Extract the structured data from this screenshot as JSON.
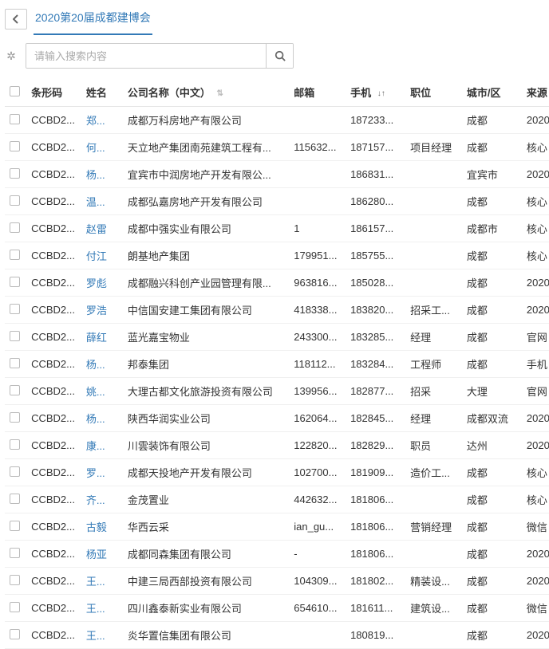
{
  "header": {
    "tab_label": "2020第20届成都建博会"
  },
  "search": {
    "placeholder": "请输入搜索内容"
  },
  "columns": {
    "barcode": "条形码",
    "name": "姓名",
    "company": "公司名称（中文）",
    "email": "邮箱",
    "phone": "手机",
    "position": "职位",
    "city": "城市/区",
    "source": "来源"
  },
  "rows": [
    {
      "barcode": "CCBD2...",
      "name": "郑...",
      "company": "成都万科房地产有限公司",
      "email": "",
      "phone": "187233...",
      "position": "",
      "city": "成都",
      "source": "2020"
    },
    {
      "barcode": "CCBD2...",
      "name": "何...",
      "company": "天立地产集团南苑建筑工程有...",
      "email": "115632...",
      "phone": "187157...",
      "position": "项目经理",
      "city": "成都",
      "source": "核心"
    },
    {
      "barcode": "CCBD2...",
      "name": "杨...",
      "company": "宜宾市中润房地产开发有限公...",
      "email": "",
      "phone": "186831...",
      "position": "",
      "city": "宜宾市",
      "source": "2020"
    },
    {
      "barcode": "CCBD2...",
      "name": "温...",
      "company": "成都弘嘉房地产开发有限公司",
      "email": "",
      "phone": "186280...",
      "position": "",
      "city": "成都",
      "source": "核心"
    },
    {
      "barcode": "CCBD2...",
      "name": "赵雷",
      "company": "成都中强实业有限公司",
      "email": "1",
      "phone": "186157...",
      "position": "",
      "city": "成都市",
      "source": "核心"
    },
    {
      "barcode": "CCBD2...",
      "name": "付江",
      "company": "朗基地产集团",
      "email": "179951...",
      "phone": "185755...",
      "position": "",
      "city": "成都",
      "source": "核心"
    },
    {
      "barcode": "CCBD2...",
      "name": "罗彪",
      "company": "成都融兴科创产业园管理有限...",
      "email": "963816...",
      "phone": "185028...",
      "position": "",
      "city": "成都",
      "source": "2020"
    },
    {
      "barcode": "CCBD2...",
      "name": "罗浩",
      "company": "中信国安建工集团有限公司",
      "email": "418338...",
      "phone": "183820...",
      "position": "招采工...",
      "city": "成都",
      "source": "2020"
    },
    {
      "barcode": "CCBD2...",
      "name": "薛红",
      "company": "蓝光嘉宝物业",
      "email": "243300...",
      "phone": "183285...",
      "position": "经理",
      "city": "成都",
      "source": "官网"
    },
    {
      "barcode": "CCBD2...",
      "name": "杨...",
      "company": "邦泰集团",
      "email": "118112...",
      "phone": "183284...",
      "position": "工程师",
      "city": "成都",
      "source": "手机"
    },
    {
      "barcode": "CCBD2...",
      "name": "姚...",
      "company": "大理古都文化旅游投资有限公司",
      "email": "139956...",
      "phone": "182877...",
      "position": "招采",
      "city": "大理",
      "source": "官网"
    },
    {
      "barcode": "CCBD2...",
      "name": "杨...",
      "company": "陕西华润实业公司",
      "email": "162064...",
      "phone": "182845...",
      "position": "经理",
      "city": "成都双流",
      "source": "2020"
    },
    {
      "barcode": "CCBD2...",
      "name": "康...",
      "company": "川雲装饰有限公司",
      "email": "122820...",
      "phone": "182829...",
      "position": "职员",
      "city": "达州",
      "source": "2020"
    },
    {
      "barcode": "CCBD2...",
      "name": "罗...",
      "company": "成都天投地产开发有限公司",
      "email": "102700...",
      "phone": "181909...",
      "position": "造价工...",
      "city": "成都",
      "source": "核心"
    },
    {
      "barcode": "CCBD2...",
      "name": "齐...",
      "company": "金茂置业",
      "email": "442632...",
      "phone": "181806...",
      "position": "",
      "city": "成都",
      "source": "核心"
    },
    {
      "barcode": "CCBD2...",
      "name": "古毅",
      "company": "华西云采",
      "email": "ian_gu...",
      "phone": "181806...",
      "position": "营销经理",
      "city": "成都",
      "source": "微信"
    },
    {
      "barcode": "CCBD2...",
      "name": "杨亚",
      "company": "成都同森集团有限公司",
      "email": "-",
      "phone": "181806...",
      "position": "",
      "city": "成都",
      "source": "2020"
    },
    {
      "barcode": "CCBD2...",
      "name": "王...",
      "company": "中建三局西部投资有限公司",
      "email": "104309...",
      "phone": "181802...",
      "position": "精装设...",
      "city": "成都",
      "source": "2020"
    },
    {
      "barcode": "CCBD2...",
      "name": "王...",
      "company": "四川鑫泰新实业有限公司",
      "email": "654610...",
      "phone": "181611...",
      "position": "建筑设...",
      "city": "成都",
      "source": "微信"
    },
    {
      "barcode": "CCBD2...",
      "name": "王...",
      "company": "炎华置信集团有限公司",
      "email": "",
      "phone": "180819...",
      "position": "",
      "city": "成都",
      "source": "2020"
    }
  ]
}
